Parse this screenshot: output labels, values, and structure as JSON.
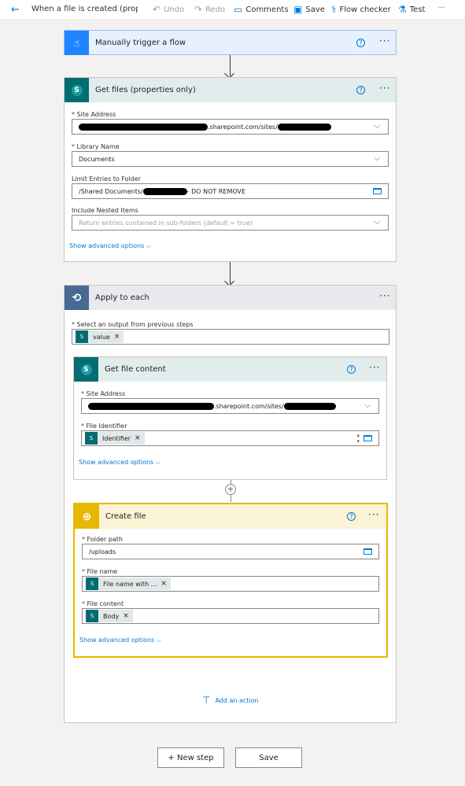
{
  "toolbar": {
    "title": "When a file is created (properti",
    "undo": "Undo",
    "redo": "Redo",
    "comments": "Comments",
    "save": "Save",
    "flow_checker": "Flow checker",
    "test": "Test",
    "more": "···"
  },
  "trigger": {
    "title": "Manually trigger a flow"
  },
  "get_files": {
    "title": "Get files (properties only)",
    "site_address_label": "Site Address",
    "site_address_value": ".sharepoint.com/sites/",
    "library_label": "Library Name",
    "library_value": "Documents",
    "limit_label": "Limit Entries to Folder",
    "limit_value_prefix": "/Shared Documents/",
    "limit_value_suffix": " - DO NOT REMOVE",
    "nested_label": "Include Nested Items",
    "nested_placeholder": "Return entries contained in sub-folders (default = true)",
    "advanced": "Show advanced options"
  },
  "apply_each": {
    "title": "Apply to each",
    "select_label": "Select an output from previous steps",
    "token": "value",
    "add_action": "Add an action"
  },
  "get_content": {
    "title": "Get file content",
    "site_address_label": "Site Address",
    "site_address_value": ".sharepoint.com/sites/",
    "file_id_label": "File Identifier",
    "file_id_token": "Identifier",
    "advanced": "Show advanced options"
  },
  "create_file": {
    "title": "Create file",
    "folder_label": "Folder path",
    "folder_value": "/uploads",
    "name_label": "File name",
    "name_token": "File name with ...",
    "content_label": "File content",
    "content_token": "Body",
    "advanced": "Show advanced options"
  },
  "footer": {
    "new_step": "+ New step",
    "save": "Save"
  },
  "colors": {
    "accent": "#0078d4",
    "trigger": "#1f85ff",
    "sharepoint": "#036c70",
    "loop": "#486991",
    "onedrive": "#e6b800"
  }
}
